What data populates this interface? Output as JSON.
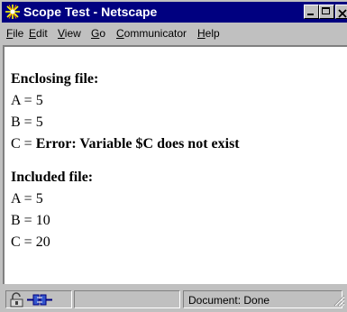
{
  "window": {
    "title": "Scope Test - Netscape",
    "titlebar_color": "#000080",
    "icon": "netscape-logo-icon"
  },
  "menubar": {
    "items": [
      {
        "label": "File",
        "hotkey": "F",
        "rest": "ile"
      },
      {
        "label": "Edit",
        "hotkey": "E",
        "rest": "dit"
      },
      {
        "label": "View",
        "hotkey": "V",
        "rest": "iew"
      },
      {
        "label": "Go",
        "hotkey": "G",
        "rest": "o"
      },
      {
        "label": "Communicator",
        "hotkey": "C",
        "rest": "ommunicator"
      },
      {
        "label": "Help",
        "hotkey": "H",
        "rest": "elp"
      }
    ]
  },
  "document": {
    "enclosing": {
      "heading": "Enclosing file:",
      "a": "A = 5",
      "b": "B = 5",
      "c_prefix": "C = ",
      "c_error": "Error: Variable $C does not exist"
    },
    "included": {
      "heading": "Included file:",
      "a": "A = 5",
      "b": "B = 10",
      "c": "C = 20"
    }
  },
  "statusbar": {
    "status_text": "Document: Done",
    "icons": [
      "security-lock-icon",
      "connection-icon"
    ]
  }
}
